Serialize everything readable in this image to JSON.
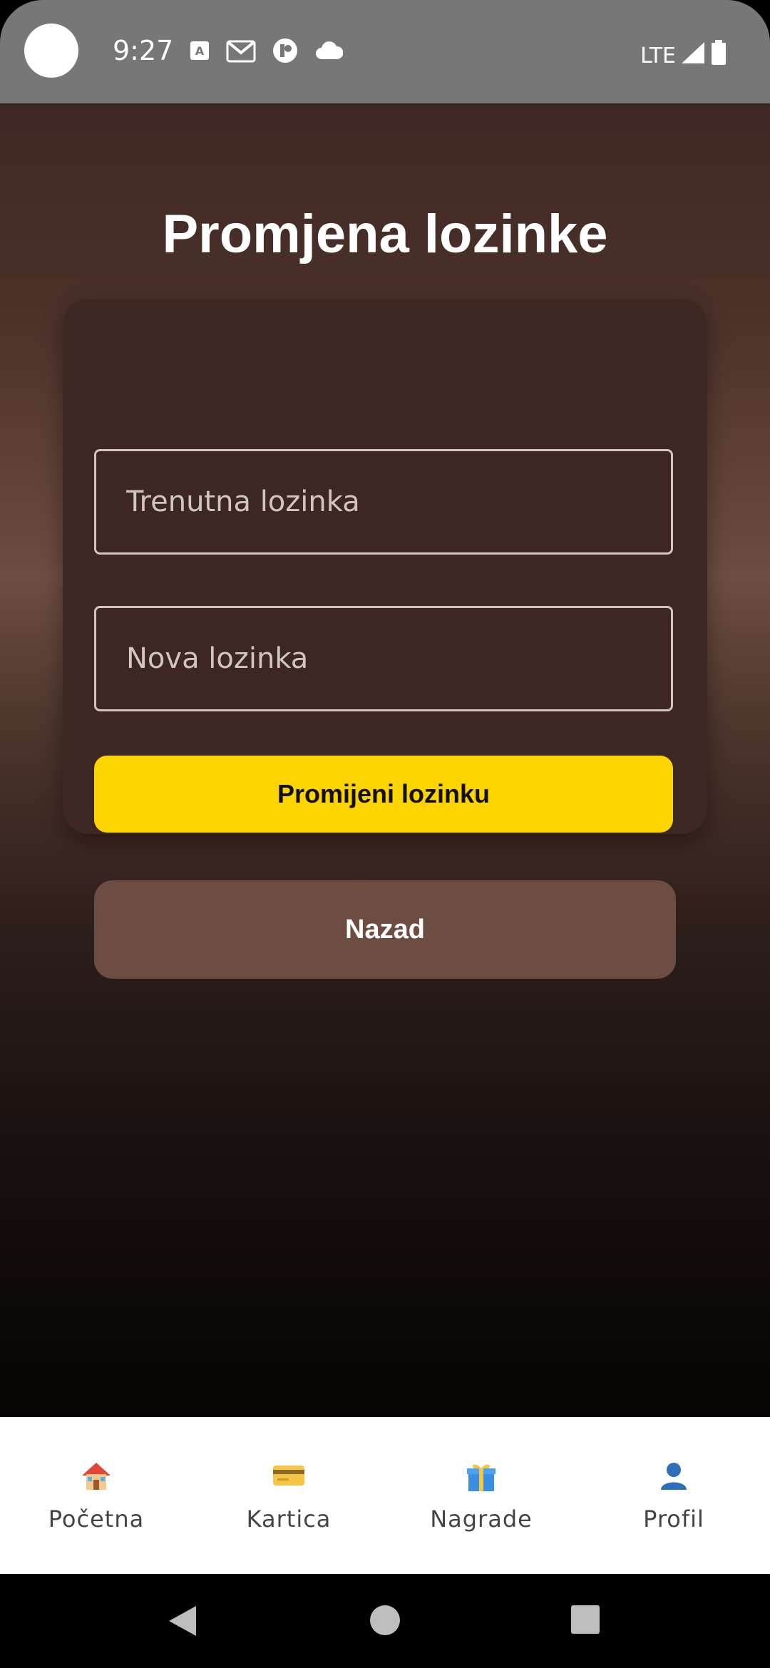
{
  "status_bar": {
    "time": "9:27",
    "network": "LTE"
  },
  "page": {
    "title": "Promjena lozinke"
  },
  "form": {
    "current_password_placeholder": "Trenutna lozinka",
    "new_password_placeholder": "Nova lozinka",
    "submit_label": "Promijeni lozinku"
  },
  "back_label": "Nazad",
  "bottom_nav": {
    "items": [
      {
        "label": "Početna",
        "icon": "house-icon"
      },
      {
        "label": "Kartica",
        "icon": "credit-card-icon"
      },
      {
        "label": "Nagrade",
        "icon": "gift-icon"
      },
      {
        "label": "Profil",
        "icon": "user-icon"
      }
    ]
  },
  "colors": {
    "accent": "#fcd400",
    "card": "#3d2723",
    "secondary_button": "#6d4c41"
  }
}
